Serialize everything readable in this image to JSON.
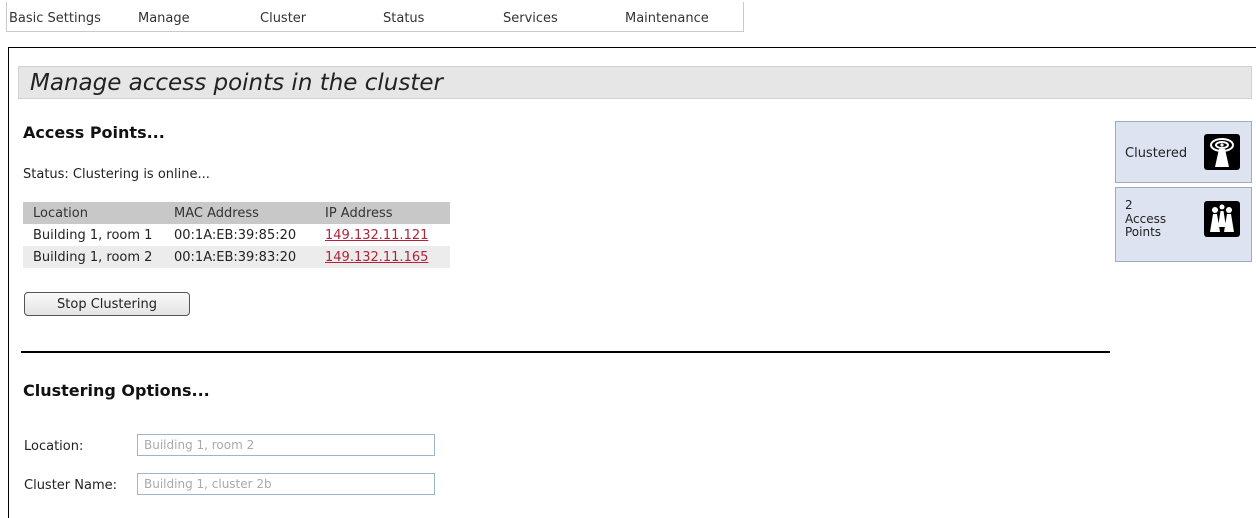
{
  "nav": {
    "items": [
      "Basic Settings",
      "Manage",
      "Cluster",
      "Status",
      "Services",
      "Maintenance"
    ]
  },
  "page_title": "Manage access points in the cluster",
  "access_points": {
    "heading": "Access Points...",
    "status": "Status: Clustering is online...",
    "columns": [
      "Location",
      "MAC Address",
      "IP Address"
    ],
    "rows": [
      {
        "location": "Building 1, room 1",
        "mac": "00:1A:EB:39:85:20",
        "ip": "149.132.11.121"
      },
      {
        "location": "Building 1, room 2",
        "mac": "00:1A:EB:39:83:20",
        "ip": "149.132.11.165"
      }
    ],
    "stop_button": "Stop Clustering"
  },
  "clustering_options": {
    "heading": "Clustering Options...",
    "location_label": "Location:",
    "location_placeholder": "Building 1, room 2",
    "cluster_name_label": "Cluster Name:",
    "cluster_name_placeholder": "Building 1, cluster 2b"
  },
  "sidebar": {
    "clustered_label": "Clustered",
    "clustered_icon": "antenna-icon",
    "ap_count": "2",
    "ap_label_line1": "Access",
    "ap_label_line2": "Points",
    "ap_icon": "access-points-group-icon"
  },
  "colors": {
    "link": "#b0243a",
    "title_bar": "#e6e6e6",
    "table_header": "#c8c8c8",
    "side_card": "#dde3f1"
  }
}
